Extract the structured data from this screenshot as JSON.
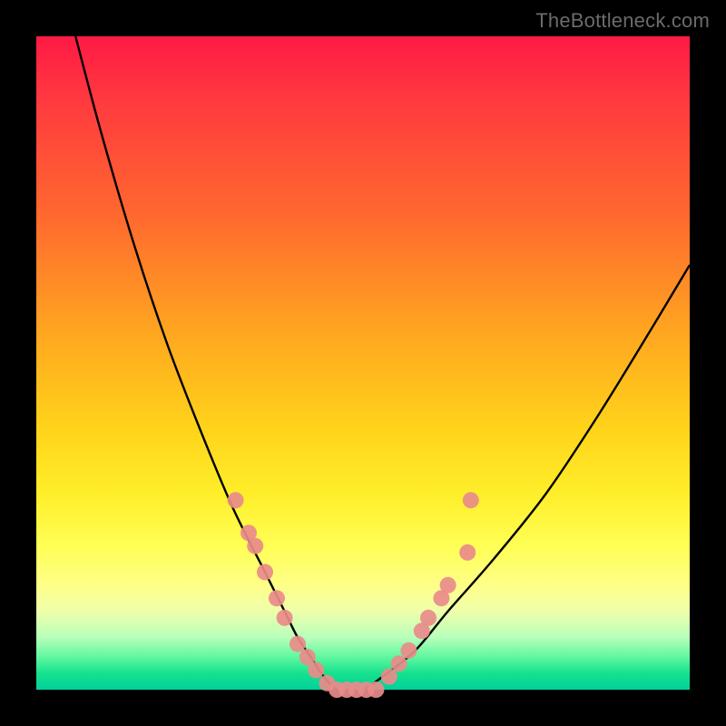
{
  "watermark": "TheBottleneck.com",
  "chart_data": {
    "type": "line",
    "title": "",
    "xlabel": "",
    "ylabel": "",
    "xlim": [
      0,
      100
    ],
    "ylim": [
      0,
      100
    ],
    "grid": false,
    "legend": false,
    "series": [
      {
        "name": "bottleneck-curve",
        "x": [
          6,
          10,
          15,
          20,
          25,
          30,
          35,
          38,
          40,
          42,
          44,
          46,
          48,
          50,
          53,
          58,
          63,
          70,
          78,
          86,
          94,
          100
        ],
        "y": [
          100,
          85,
          68,
          53,
          40,
          28,
          18,
          12,
          8,
          5,
          2,
          0,
          0,
          0,
          2,
          6,
          12,
          20,
          30,
          42,
          55,
          65
        ]
      }
    ],
    "markers": [
      {
        "name": "left-cluster",
        "color": "#e98b8a",
        "points": [
          {
            "x": 30.5,
            "y": 29
          },
          {
            "x": 32.5,
            "y": 24
          },
          {
            "x": 33.5,
            "y": 22
          },
          {
            "x": 35.0,
            "y": 18
          },
          {
            "x": 36.8,
            "y": 14
          },
          {
            "x": 38.0,
            "y": 11
          },
          {
            "x": 40.0,
            "y": 7
          },
          {
            "x": 41.5,
            "y": 5
          },
          {
            "x": 42.8,
            "y": 3
          },
          {
            "x": 44.5,
            "y": 1
          }
        ]
      },
      {
        "name": "bottom-cluster",
        "color": "#e98b8a",
        "points": [
          {
            "x": 46.0,
            "y": 0
          },
          {
            "x": 47.5,
            "y": 0
          },
          {
            "x": 49.0,
            "y": 0
          },
          {
            "x": 50.5,
            "y": 0
          },
          {
            "x": 52.0,
            "y": 0
          }
        ]
      },
      {
        "name": "right-cluster",
        "color": "#e98b8a",
        "points": [
          {
            "x": 54.0,
            "y": 2
          },
          {
            "x": 55.5,
            "y": 4
          },
          {
            "x": 57.0,
            "y": 6
          },
          {
            "x": 59.0,
            "y": 9
          },
          {
            "x": 60.0,
            "y": 11
          },
          {
            "x": 62.0,
            "y": 14
          },
          {
            "x": 63.0,
            "y": 16
          },
          {
            "x": 66.0,
            "y": 21
          },
          {
            "x": 66.5,
            "y": 29
          }
        ]
      }
    ]
  }
}
